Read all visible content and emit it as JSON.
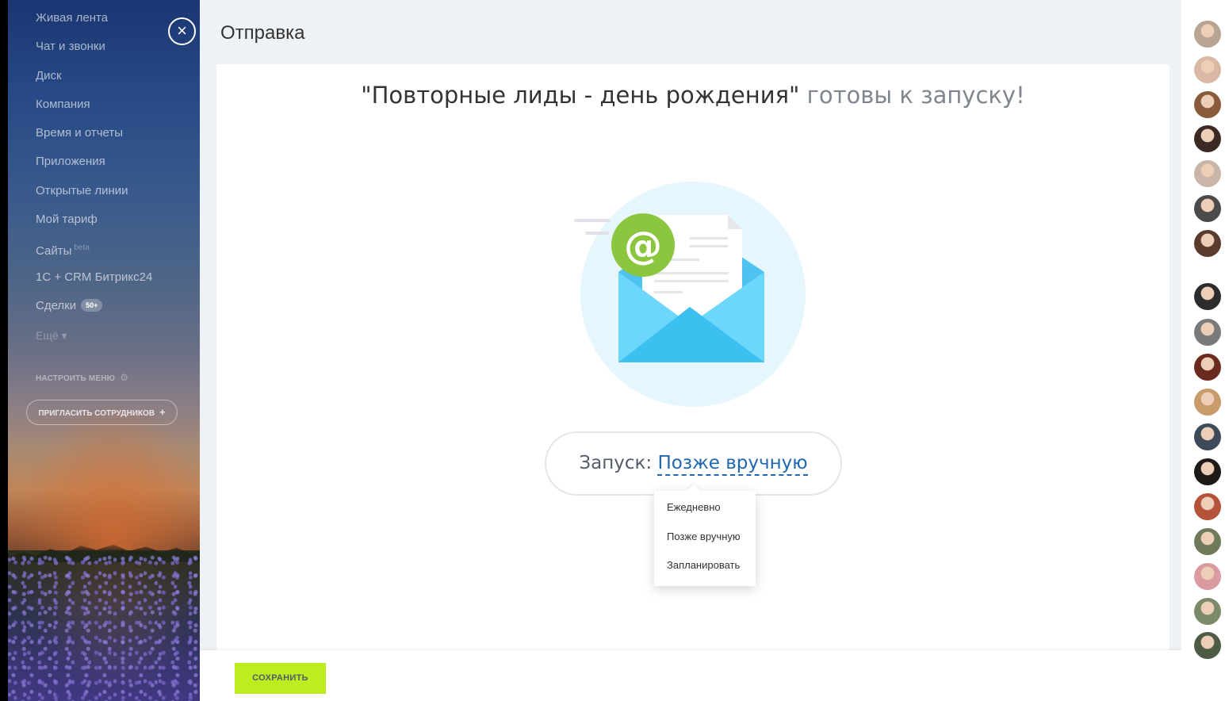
{
  "sidebar": {
    "items": [
      {
        "label": "Живая лента"
      },
      {
        "label": "Чат и звонки"
      },
      {
        "label": "Диск"
      },
      {
        "label": "Компания"
      },
      {
        "label": "Время и отчеты"
      },
      {
        "label": "Приложения"
      },
      {
        "label": "Открытые линии"
      },
      {
        "label": "Мой тариф"
      },
      {
        "label": "Сайты",
        "sup": "beta"
      },
      {
        "label": "1С + CRM Битрикс24"
      },
      {
        "label": "Сделки",
        "badge": "50+"
      }
    ],
    "more_label": "Ещё",
    "settings_label": "НАСТРОИТЬ МЕНЮ",
    "invite_label": "ПРИГЛАСИТЬ СОТРУДНИКОВ",
    "close_icon": "close-icon"
  },
  "main": {
    "page_title": "Отправка",
    "headline_name": "\"Повторные лиды - день рождения\"",
    "headline_rest": " готовы к запуску!",
    "launch_label": "Запуск:",
    "launch_value": "Позже вручную",
    "dropdown_options": [
      {
        "label": "Ежедневно"
      },
      {
        "label": "Позже вручную"
      },
      {
        "label": "Запланировать"
      }
    ],
    "illustration_icon": "email-envelope-icon",
    "save_label": "СОХРАНИТЬ"
  },
  "colors": {
    "accent_link": "#2067b0",
    "save_button": "#bbed21",
    "at_badge": "#8cc63f",
    "envelope": "#5fd0f6"
  },
  "userbar": {
    "avatars": [
      {
        "color": "#b8a493"
      },
      {
        "color": "#d9b9a5"
      },
      {
        "color": "#8a5a3c"
      },
      {
        "color": "#3b2a24"
      },
      {
        "color": "#c9b6a8"
      },
      {
        "color": "#4b4b4b"
      },
      {
        "color": "#5a3b2e"
      },
      {
        "color": "#2c2c2c"
      },
      {
        "color": "#7a7a7a"
      },
      {
        "color": "#6b2a20"
      },
      {
        "color": "#c99a6a"
      },
      {
        "color": "#3d4a5a"
      },
      {
        "color": "#1e1a18"
      },
      {
        "color": "#b5523a"
      },
      {
        "color": "#6f7a5a"
      },
      {
        "color": "#d99aa0"
      },
      {
        "color": "#7c8a6a"
      },
      {
        "color": "#4d5a44"
      }
    ]
  }
}
